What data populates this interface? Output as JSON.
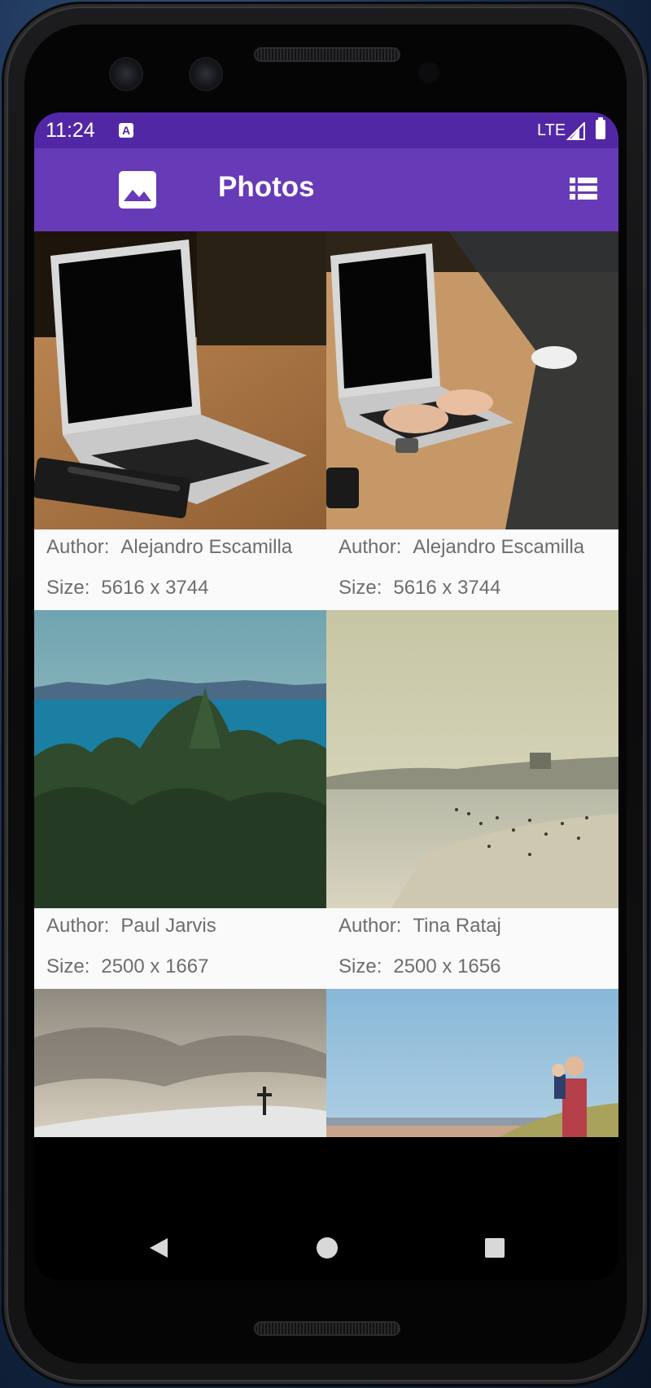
{
  "status_bar": {
    "time": "11:24",
    "network": "LTE"
  },
  "app_bar": {
    "title": "Photos"
  },
  "photos": [
    {
      "author_label": "Author:",
      "author": "Alejandro Escamilla",
      "size_label": "Size:",
      "size": "5616 x 3744",
      "subject": "laptop-on-desk"
    },
    {
      "author_label": "Author:",
      "author": "Alejandro Escamilla",
      "size_label": "Size:",
      "size": "5616 x 3744",
      "subject": "person-typing-on-laptop"
    },
    {
      "author_label": "Author:",
      "author": "Paul Jarvis",
      "size_label": "Size:",
      "size": "2500 x 1667",
      "subject": "forest-and-sea"
    },
    {
      "author_label": "Author:",
      "author": "Tina Rataj",
      "size_label": "Size:",
      "size": "2500 x 1656",
      "subject": "hazy-beach"
    },
    {
      "subject": "snowy-hill-with-cross"
    },
    {
      "subject": "father-and-child-on-beach"
    }
  ],
  "colors": {
    "status_bar": "#5127a6",
    "app_bar": "#673ab7",
    "caption_text": "#6d6d6d"
  }
}
